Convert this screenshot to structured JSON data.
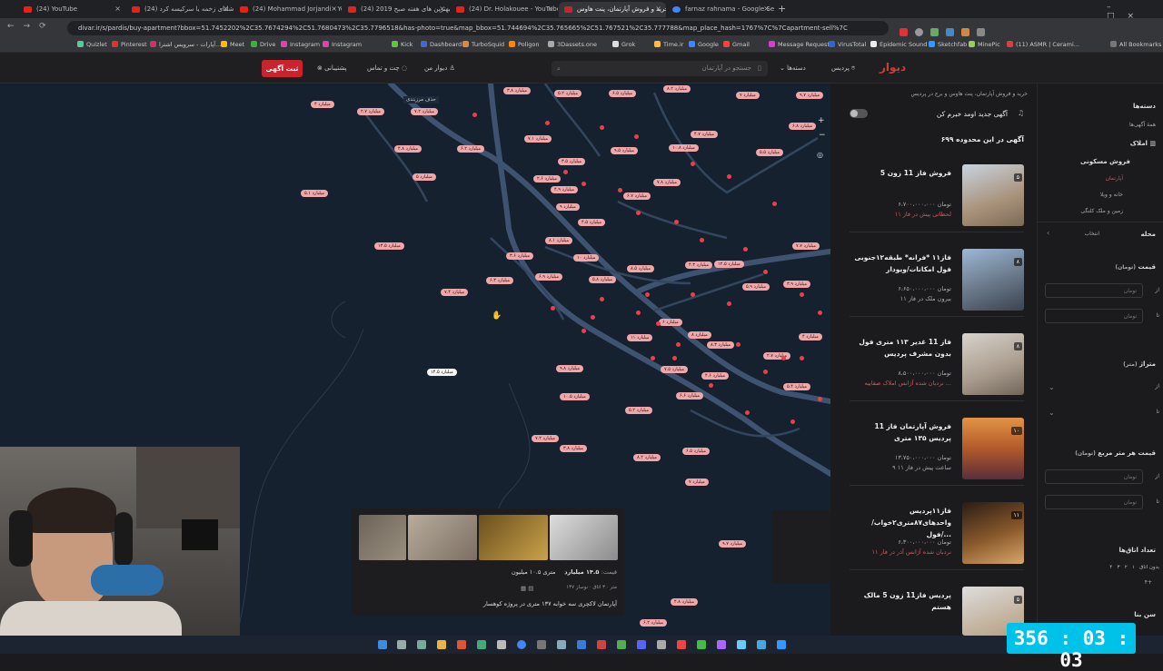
{
  "browser": {
    "tabs": [
      {
        "label": "(24) YouTube",
        "active": false
      },
      {
        "label": "(24) شلنای زخمه یا سرکیسه کرد...",
        "active": false
      },
      {
        "label": "(24) Mohammad Jorjandi - You...",
        "active": false
      },
      {
        "label": "(24) بهترین های هفته صبح 2019...",
        "active": false
      },
      {
        "label": "(24) Dr. Holakouee - YouTube",
        "active": false
      },
      {
        "label": "خرید و فروش آپارتمان، پنت هاوس...",
        "active": true
      },
      {
        "label": "farnaz rahnama - Google Search",
        "active": false
      }
    ],
    "url": "divar.ir/s/pardis/buy-apartment?bbox=51.7452202%2C35.7674294%2C51.7680473%2C35.7796518&has-photo=true&map_bbox=51.744694%2C35.765665%2C51.767521%2C35.777788&map_place_hash=1767%7C%7Capartment-sell%7C",
    "bookmarks": [
      "Quizlet",
      "Pinterest",
      "آپارات - سرویس اشترا...",
      "Meet",
      "Drive",
      "Instagram",
      "Instagram",
      "Kick",
      "Dashboard",
      "TurboSquid",
      "Poligon",
      "3Dassets.one",
      "Grok",
      "Time.ir",
      "Google",
      "Gmail",
      "Message Requests",
      "VirusTotal",
      "Epidemic Sound",
      "Sketchfab",
      "MinePic",
      "(11) ASMR | Cerami...",
      "All Bookmarks"
    ]
  },
  "header": {
    "logo": "دیوار",
    "city": "پردیس",
    "categories": "دسته‌ها",
    "search_placeholder": "جستجو در آپارتمان",
    "my_divar": "دیوار من",
    "chat": "چت و تماس",
    "support": "پشتیبانی",
    "post_ad": "ثبت آگهی"
  },
  "map": {
    "pins": [
      "۴ میلیارد",
      "۲.۷ میلیارد",
      "۷.۲ میلیارد",
      "۳.۸ میلیارد",
      "۵.۲ میلیارد",
      "۶.۵ میلیارد",
      "۸.۲ میلیارد",
      "۷ میلیارد",
      "۹.۷ میلیارد",
      "۴.۸ میلیارد",
      "۶.۲ میلیارد",
      "۵ میلیارد",
      "۷.۱ میلیارد",
      "۳.۵ میلیارد",
      "۲.۶ میلیارد",
      "۴.۹ میلیارد",
      "۹.۵ میلیارد",
      "۱۰.۸ میلیارد",
      "۴.۷ میلیارد",
      "۵.۵ میلیارد",
      "۶.۸ میلیارد",
      "۵.۱ میلیارد",
      "۱۳.۵ میلیارد",
      "۷.۴ میلیارد",
      "۶.۳ میلیارد",
      "۳.۶ میلیارد",
      "۸.۱ میلیارد",
      "۶.۹ میلیارد",
      "۱۰ میلیارد",
      "۵.۸ میلیارد",
      "۴.۵ میلیارد",
      "۶.۷ میلیارد",
      "۷.۸ میلیارد",
      "۹ میلیارد",
      "۸.۵ میلیارد",
      "۴.۳ میلیارد",
      "۱۲.۵ میلیارد",
      "۵.۹ میلیارد",
      "۳.۹ میلیارد",
      "۷.۷ میلیارد",
      "۶ میلیارد",
      "۸ میلیارد",
      "۱۱ میلیارد",
      "۷.۵ میلیارد",
      "۴.۶ میلیارد",
      "۹.۸ میلیارد",
      "۱۰.۵ میلیارد",
      "۶.۶ میلیارد",
      "۸.۳ میلیارد",
      "۵.۴ میلیارد"
    ],
    "selected_pin": "۱۴.۵ میلیارد",
    "area_label": "حذف مرزبندی",
    "card": {
      "price_label": "قیمت:",
      "price": "۱۴.۵ میلیارد",
      "per_meter": "متری ۱۰.۵ میلیون",
      "meta": [
        "۱۳۷ متر",
        "۳ اتاق",
        "نوساز"
      ],
      "title": "آپارتمان لاکچری سه خوابه ۱۳۷ متری در پروژه کوهسار"
    }
  },
  "listing": {
    "breadcrumb": "خرید و فروش آپارتمان، پنت هاوس و برج در پردیس",
    "notify_label": "آگهی جدید اومد خبرم کن",
    "count": "۶۹۹ آگهی در این محدوده",
    "items": [
      {
        "title": "فروش فاز 11 زون 5",
        "price": "۶،۷۰۰،۰۰۰،۰۰۰ تومان",
        "meta": "لحظاتی پیش در فاز ۱۱",
        "badge": "۵"
      },
      {
        "title": "فاز۱۱ *فرانه* طبقه۱۲جنوبی فول امکانات/ویودار",
        "price": "۶،۶۵۰،۰۰۰،۰۰۰ تومان",
        "meta": "بیرون ملک در فاز ۱۱",
        "badge": "۸"
      },
      {
        "title": "فاز 11 غدیر ۱۱۳ متری فول بدون مشرف پردیس",
        "price": "۸،۵۰۰،۰۰۰،۰۰۰ تومان",
        "meta": "نردبان شده آژانس املاک صفاییه ...",
        "badge": "۸"
      },
      {
        "title": "فروش آپارتمان فاز 11 پردیس ۱۳۵ متری",
        "price": "۱۳،۷۵۰،۰۰۰،۰۰۰ تومان",
        "meta": "۹ ساعت پیش در فاز ۱۱",
        "badge": "۱۰"
      },
      {
        "title": "فاز۱۱پردیس واحدهای۸۷متری۲خواب/فول/...",
        "price": "۶،۳۰۰،۰۰۰،۰۰۰ تومان",
        "meta": "نردبان شده آژانس آذر در فاز ۱۱",
        "badge": "۱۱"
      },
      {
        "title": "پردیس فاز11 زون 5 مالک هستم",
        "price": "",
        "meta": "",
        "badge": "۵"
      }
    ]
  },
  "filters": {
    "categories_title": "دسته‌ها",
    "all_ads": "همهٔ آگهی‌ها",
    "real_estate": "املاک",
    "residential_sale": "فروش مسکونی",
    "sub": [
      "آپارتمان",
      "خانه و ویلا",
      "زمین و ملک کلنگی"
    ],
    "neighborhood": "محله",
    "select": "انتخاب",
    "price": "قیمت",
    "price_unit": "(تومان)",
    "from": "از",
    "to": "تا",
    "toman": "تومان",
    "area": "متراژ",
    "area_unit": "(متر)",
    "price_per_meter": "قیمت هر متر مربع",
    "rooms": "تعداد اتاق‌ها",
    "room_options": [
      "بدون اتاق",
      "۱",
      "۲",
      "۳",
      "۴",
      "۴+"
    ],
    "building_age": "سن بنا"
  },
  "timer": "356 : 03 : 03",
  "colors": {
    "accent": "#c8242e",
    "pin": "#f0a7a9",
    "map_bg": "#16212f",
    "timer": "#00c2e8"
  }
}
